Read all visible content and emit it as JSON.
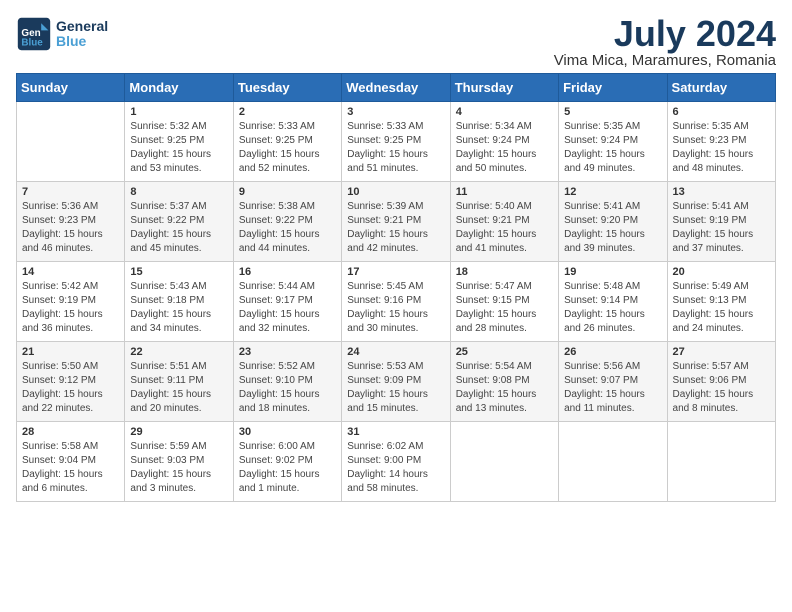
{
  "header": {
    "logo_line1": "General",
    "logo_line2": "Blue",
    "title": "July 2024",
    "subtitle": "Vima Mica, Maramures, Romania"
  },
  "columns": [
    "Sunday",
    "Monday",
    "Tuesday",
    "Wednesday",
    "Thursday",
    "Friday",
    "Saturday"
  ],
  "weeks": [
    [
      {
        "day": "",
        "sunrise": "",
        "sunset": "",
        "daylight": ""
      },
      {
        "day": "1",
        "sunrise": "Sunrise: 5:32 AM",
        "sunset": "Sunset: 9:25 PM",
        "daylight": "Daylight: 15 hours and 53 minutes."
      },
      {
        "day": "2",
        "sunrise": "Sunrise: 5:33 AM",
        "sunset": "Sunset: 9:25 PM",
        "daylight": "Daylight: 15 hours and 52 minutes."
      },
      {
        "day": "3",
        "sunrise": "Sunrise: 5:33 AM",
        "sunset": "Sunset: 9:25 PM",
        "daylight": "Daylight: 15 hours and 51 minutes."
      },
      {
        "day": "4",
        "sunrise": "Sunrise: 5:34 AM",
        "sunset": "Sunset: 9:24 PM",
        "daylight": "Daylight: 15 hours and 50 minutes."
      },
      {
        "day": "5",
        "sunrise": "Sunrise: 5:35 AM",
        "sunset": "Sunset: 9:24 PM",
        "daylight": "Daylight: 15 hours and 49 minutes."
      },
      {
        "day": "6",
        "sunrise": "Sunrise: 5:35 AM",
        "sunset": "Sunset: 9:23 PM",
        "daylight": "Daylight: 15 hours and 48 minutes."
      }
    ],
    [
      {
        "day": "7",
        "sunrise": "Sunrise: 5:36 AM",
        "sunset": "Sunset: 9:23 PM",
        "daylight": "Daylight: 15 hours and 46 minutes."
      },
      {
        "day": "8",
        "sunrise": "Sunrise: 5:37 AM",
        "sunset": "Sunset: 9:22 PM",
        "daylight": "Daylight: 15 hours and 45 minutes."
      },
      {
        "day": "9",
        "sunrise": "Sunrise: 5:38 AM",
        "sunset": "Sunset: 9:22 PM",
        "daylight": "Daylight: 15 hours and 44 minutes."
      },
      {
        "day": "10",
        "sunrise": "Sunrise: 5:39 AM",
        "sunset": "Sunset: 9:21 PM",
        "daylight": "Daylight: 15 hours and 42 minutes."
      },
      {
        "day": "11",
        "sunrise": "Sunrise: 5:40 AM",
        "sunset": "Sunset: 9:21 PM",
        "daylight": "Daylight: 15 hours and 41 minutes."
      },
      {
        "day": "12",
        "sunrise": "Sunrise: 5:41 AM",
        "sunset": "Sunset: 9:20 PM",
        "daylight": "Daylight: 15 hours and 39 minutes."
      },
      {
        "day": "13",
        "sunrise": "Sunrise: 5:41 AM",
        "sunset": "Sunset: 9:19 PM",
        "daylight": "Daylight: 15 hours and 37 minutes."
      }
    ],
    [
      {
        "day": "14",
        "sunrise": "Sunrise: 5:42 AM",
        "sunset": "Sunset: 9:19 PM",
        "daylight": "Daylight: 15 hours and 36 minutes."
      },
      {
        "day": "15",
        "sunrise": "Sunrise: 5:43 AM",
        "sunset": "Sunset: 9:18 PM",
        "daylight": "Daylight: 15 hours and 34 minutes."
      },
      {
        "day": "16",
        "sunrise": "Sunrise: 5:44 AM",
        "sunset": "Sunset: 9:17 PM",
        "daylight": "Daylight: 15 hours and 32 minutes."
      },
      {
        "day": "17",
        "sunrise": "Sunrise: 5:45 AM",
        "sunset": "Sunset: 9:16 PM",
        "daylight": "Daylight: 15 hours and 30 minutes."
      },
      {
        "day": "18",
        "sunrise": "Sunrise: 5:47 AM",
        "sunset": "Sunset: 9:15 PM",
        "daylight": "Daylight: 15 hours and 28 minutes."
      },
      {
        "day": "19",
        "sunrise": "Sunrise: 5:48 AM",
        "sunset": "Sunset: 9:14 PM",
        "daylight": "Daylight: 15 hours and 26 minutes."
      },
      {
        "day": "20",
        "sunrise": "Sunrise: 5:49 AM",
        "sunset": "Sunset: 9:13 PM",
        "daylight": "Daylight: 15 hours and 24 minutes."
      }
    ],
    [
      {
        "day": "21",
        "sunrise": "Sunrise: 5:50 AM",
        "sunset": "Sunset: 9:12 PM",
        "daylight": "Daylight: 15 hours and 22 minutes."
      },
      {
        "day": "22",
        "sunrise": "Sunrise: 5:51 AM",
        "sunset": "Sunset: 9:11 PM",
        "daylight": "Daylight: 15 hours and 20 minutes."
      },
      {
        "day": "23",
        "sunrise": "Sunrise: 5:52 AM",
        "sunset": "Sunset: 9:10 PM",
        "daylight": "Daylight: 15 hours and 18 minutes."
      },
      {
        "day": "24",
        "sunrise": "Sunrise: 5:53 AM",
        "sunset": "Sunset: 9:09 PM",
        "daylight": "Daylight: 15 hours and 15 minutes."
      },
      {
        "day": "25",
        "sunrise": "Sunrise: 5:54 AM",
        "sunset": "Sunset: 9:08 PM",
        "daylight": "Daylight: 15 hours and 13 minutes."
      },
      {
        "day": "26",
        "sunrise": "Sunrise: 5:56 AM",
        "sunset": "Sunset: 9:07 PM",
        "daylight": "Daylight: 15 hours and 11 minutes."
      },
      {
        "day": "27",
        "sunrise": "Sunrise: 5:57 AM",
        "sunset": "Sunset: 9:06 PM",
        "daylight": "Daylight: 15 hours and 8 minutes."
      }
    ],
    [
      {
        "day": "28",
        "sunrise": "Sunrise: 5:58 AM",
        "sunset": "Sunset: 9:04 PM",
        "daylight": "Daylight: 15 hours and 6 minutes."
      },
      {
        "day": "29",
        "sunrise": "Sunrise: 5:59 AM",
        "sunset": "Sunset: 9:03 PM",
        "daylight": "Daylight: 15 hours and 3 minutes."
      },
      {
        "day": "30",
        "sunrise": "Sunrise: 6:00 AM",
        "sunset": "Sunset: 9:02 PM",
        "daylight": "Daylight: 15 hours and 1 minute."
      },
      {
        "day": "31",
        "sunrise": "Sunrise: 6:02 AM",
        "sunset": "Sunset: 9:00 PM",
        "daylight": "Daylight: 14 hours and 58 minutes."
      },
      {
        "day": "",
        "sunrise": "",
        "sunset": "",
        "daylight": ""
      },
      {
        "day": "",
        "sunrise": "",
        "sunset": "",
        "daylight": ""
      },
      {
        "day": "",
        "sunrise": "",
        "sunset": "",
        "daylight": ""
      }
    ]
  ]
}
